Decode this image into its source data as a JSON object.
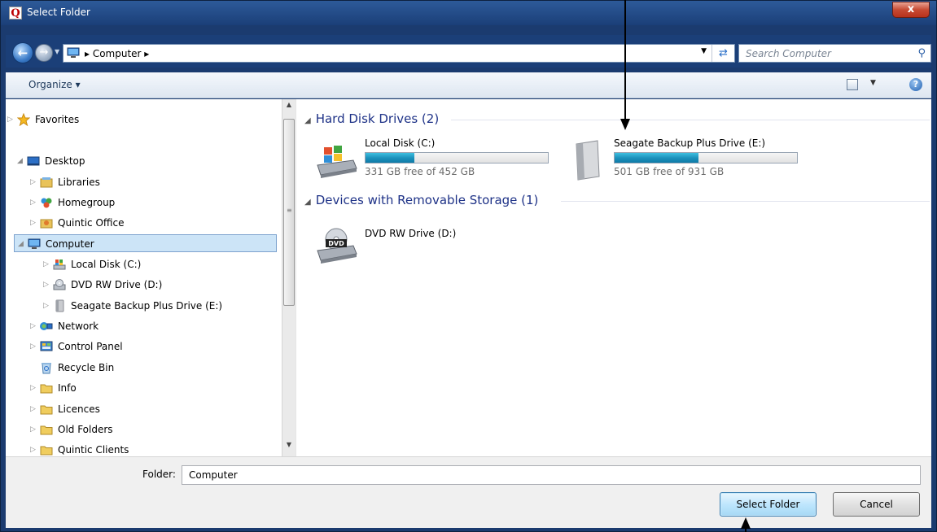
{
  "window": {
    "title": "Select Folder",
    "close_label": "x",
    "app_icon_letter": "Q"
  },
  "navigation": {
    "address_path": "▸ Computer ▸",
    "search_placeholder": "Search Computer"
  },
  "toolbar": {
    "organize_label": "Organize ▾"
  },
  "tree": {
    "items": [
      {
        "label": "Favorites",
        "icon": "star-icon",
        "expanded": false
      },
      {
        "label": "Desktop",
        "icon": "desktop-icon",
        "expanded": true
      },
      {
        "label": "Libraries",
        "icon": "libraries-icon",
        "expanded": false
      },
      {
        "label": "Homegroup",
        "icon": "homegroup-icon",
        "expanded": false
      },
      {
        "label": "Quintic Office",
        "icon": "user-folder-icon",
        "expanded": false
      },
      {
        "label": "Computer",
        "icon": "computer-icon",
        "expanded": true,
        "selected": true
      },
      {
        "label": "Local Disk (C:)",
        "icon": "local-disk-icon",
        "expanded": false
      },
      {
        "label": "DVD RW Drive (D:)",
        "icon": "dvd-drive-icon",
        "expanded": false
      },
      {
        "label": "Seagate Backup Plus Drive (E:)",
        "icon": "external-drive-icon",
        "expanded": false
      },
      {
        "label": "Network",
        "icon": "network-icon",
        "expanded": false
      },
      {
        "label": "Control Panel",
        "icon": "control-panel-icon",
        "expanded": false
      },
      {
        "label": "Recycle Bin",
        "icon": "recycle-bin-icon",
        "expanded": false
      },
      {
        "label": "Info",
        "icon": "folder-icon",
        "expanded": false
      },
      {
        "label": "Licences",
        "icon": "folder-icon",
        "expanded": false
      },
      {
        "label": "Old Folders",
        "icon": "folder-icon",
        "expanded": false
      },
      {
        "label": "Quintic Clients",
        "icon": "folder-icon",
        "expanded": false
      }
    ]
  },
  "content": {
    "groups": [
      {
        "title": "Hard Disk Drives (2)"
      },
      {
        "title": "Devices with Removable Storage (1)"
      }
    ],
    "drives": [
      {
        "name": "Local Disk (C:)",
        "free_text": "331 GB free of 452 GB",
        "used_fraction": 0.27,
        "icon": "windows-disk-icon"
      },
      {
        "name": "Seagate Backup Plus Drive (E:)",
        "free_text": "501 GB free of 931 GB",
        "used_fraction": 0.46,
        "icon": "external-drive-icon"
      },
      {
        "name": "DVD RW Drive (D:)",
        "icon": "dvd-drive-icon",
        "dvd_badge": "DVD"
      }
    ]
  },
  "footer": {
    "folder_label": "Folder:",
    "folder_value": "Computer",
    "select_button": "Select Folder",
    "cancel_button": "Cancel"
  }
}
